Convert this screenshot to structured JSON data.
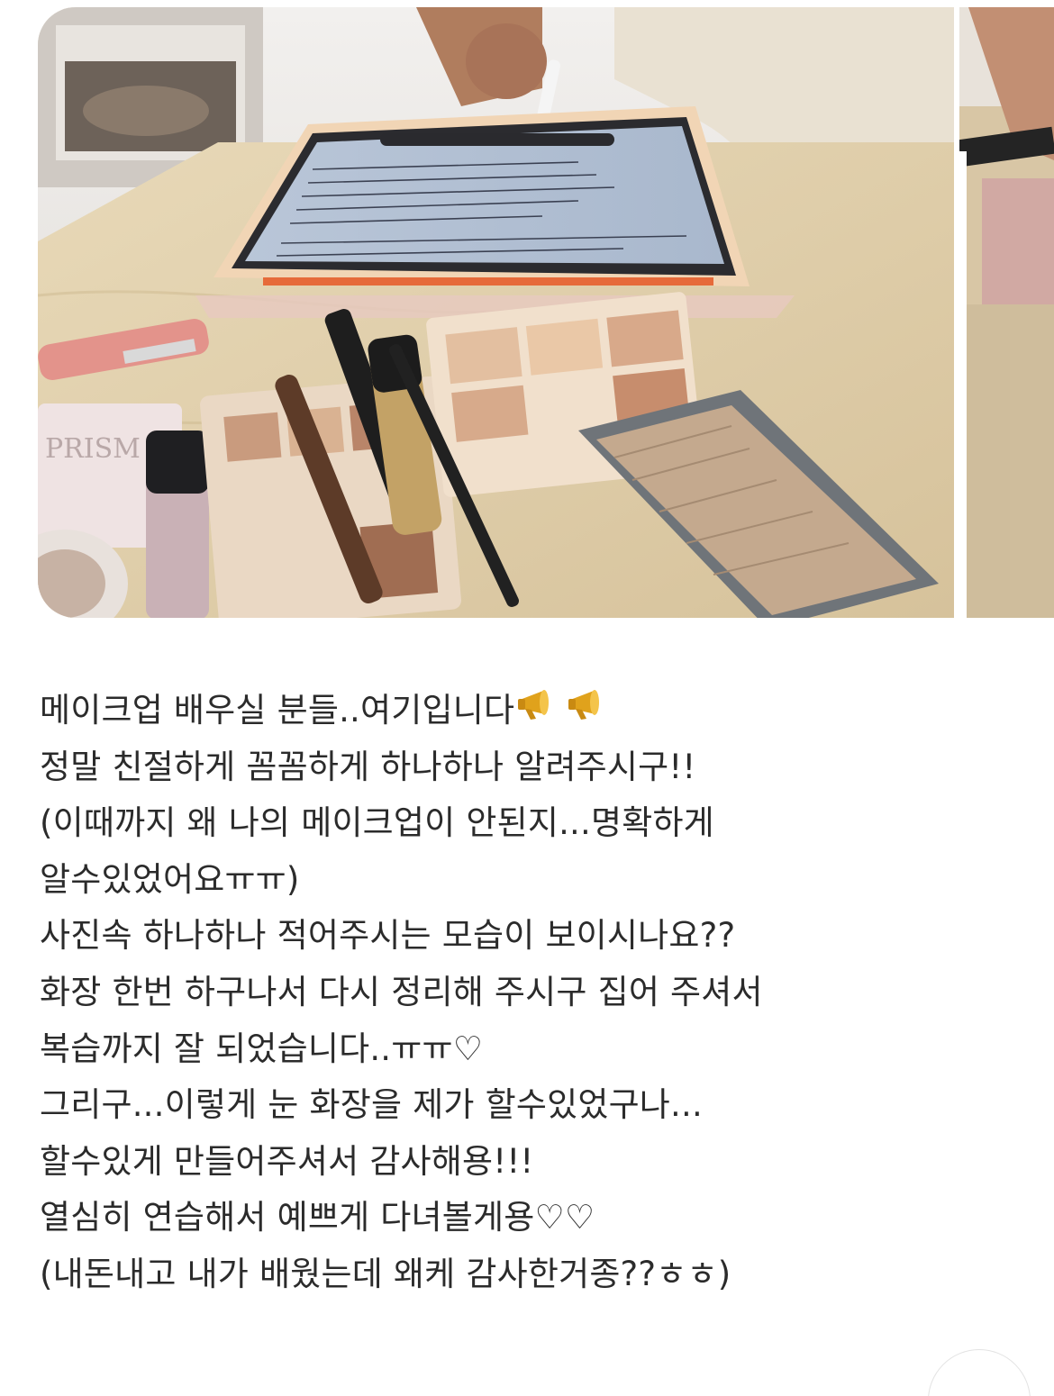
{
  "photos": [
    {
      "name": "makeup-class-photo",
      "kind": "current"
    },
    {
      "name": "next-photo-preview",
      "kind": "next"
    }
  ],
  "post": {
    "lines": [
      {
        "text": "메이크업 배우실 분들..여기입니다",
        "trailing_icons": [
          "megaphone-icon",
          "megaphone-icon"
        ]
      },
      {
        "text": "정말 친절하게 꼼꼼하게 하나하나 알려주시구!!"
      },
      {
        "text": "(이때까지 왜 나의 메이크업이 안된지...명확하게"
      },
      {
        "text": "알수있었어요ㅠㅠ)"
      },
      {
        "text": "사진속 하나하나 적어주시는 모습이 보이시나요??"
      },
      {
        "text": "화장 한번 하구나서 다시 정리해 주시구 집어 주셔서"
      },
      {
        "text": "복습까지 잘 되었습니다..ㅠㅠ♡"
      },
      {
        "text": "그리구...이렇게 눈 화장을 제가 할수있었구나..."
      },
      {
        "text": "할수있게 만들어주셔서 감사해용!!!"
      },
      {
        "text": "열심히 연습해서 예쁘게 다녀볼게용♡♡"
      },
      {
        "text": "(내돈내고 내가 배웠는데 왜케 감사한거종??ㅎㅎ)"
      }
    ]
  },
  "colors": {
    "text": "#2b2b2b",
    "megaphone": "#e0a21c",
    "background": "#ffffff"
  }
}
